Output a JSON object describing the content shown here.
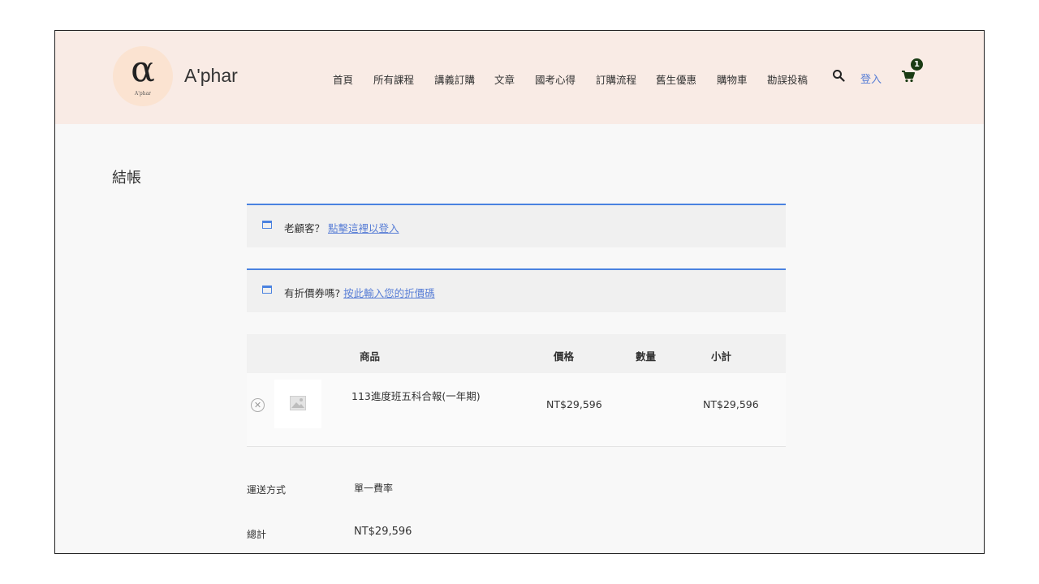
{
  "header": {
    "logo_symbol": "α",
    "logo_small_text": "A'phar",
    "site_name": "A'phar",
    "nav": [
      "首頁",
      "所有課程",
      "講義訂購",
      "文章",
      "國考心得",
      "訂購流程",
      "舊生優惠",
      "購物車",
      "勘誤投稿"
    ],
    "login_label": "登入",
    "cart_count": "1"
  },
  "page": {
    "title": "結帳"
  },
  "notices": {
    "returning_customer": {
      "text": "老顧客？",
      "link": "點擊這裡以登入"
    },
    "coupon": {
      "text": "有折價券嗎?",
      "link": "按此輸入您的折價碼"
    }
  },
  "cart_table": {
    "headers": {
      "product": "商品",
      "price": "價格",
      "quantity": "數量",
      "subtotal": "小計"
    },
    "row": {
      "remove_symbol": "✕",
      "product_name": "113進度班五科合報(一年期)",
      "price": "NT$29,596",
      "quantity": "",
      "subtotal": "NT$29,596"
    }
  },
  "summary": {
    "shipping_label": "運送方式",
    "shipping_value": "單一費率",
    "total_label": "總計",
    "total_value": "NT$29,596"
  },
  "colors": {
    "header_bg": "#f9ebe5",
    "accent_blue": "#4a82e0",
    "link_blue": "#5a7fd6",
    "cart_badge": "#1a3b14"
  }
}
